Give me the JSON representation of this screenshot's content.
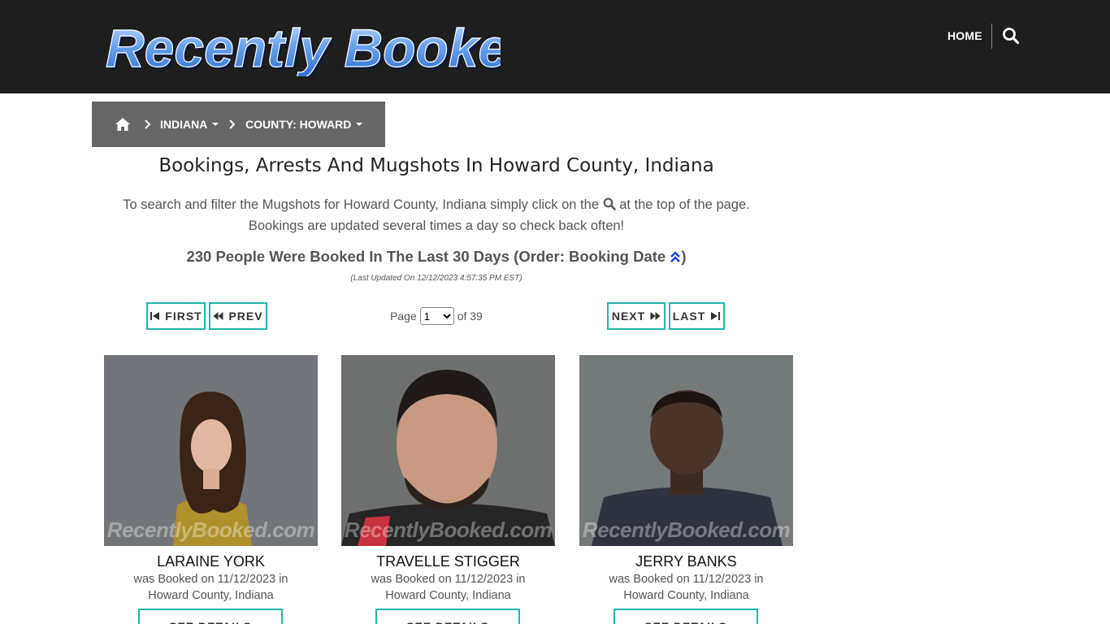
{
  "header": {
    "logo_text": "Recently Booked",
    "nav_home": "HOME"
  },
  "breadcrumb": {
    "state": "INDIANA",
    "county": "COUNTY: HOWARD"
  },
  "main": {
    "title": "Bookings, Arrests And Mugshots In Howard County, Indiana",
    "intro_part1": "To search and filter the Mugshots for Howard County, Indiana simply click on the",
    "intro_part2": "at the top of the page.",
    "intro_line2": "Bookings are updated several times a day so check back often!",
    "count_text": "230 People Were Booked In The Last 30 Days (Order: Booking Date",
    "count_close": ")",
    "last_updated": "(Last Updated On 12/12/2023 4:57:35 PM EST)"
  },
  "pagination": {
    "first": "FIRST",
    "prev": "PREV",
    "next": "NEXT",
    "last": "LAST",
    "page_label": "Page",
    "current_page": "1",
    "of_label": "of 39"
  },
  "bookings": [
    {
      "name": "LARAINE YORK",
      "booked_line1": "was Booked on 11/12/2023 in",
      "booked_line2": "Howard County, Indiana",
      "details_label": "SEE DETAILS",
      "watermark": "RecentlyBooked.com"
    },
    {
      "name": "TRAVELLE STIGGER",
      "booked_line1": "was Booked on 11/12/2023 in",
      "booked_line2": "Howard County, Indiana",
      "details_label": "SEE DETAILS",
      "watermark": "RecentlyBooked.com"
    },
    {
      "name": "JERRY BANKS",
      "booked_line1": "was Booked on 11/12/2023 in",
      "booked_line2": "Howard County, Indiana",
      "details_label": "SEE DETAILS",
      "watermark": "RecentlyBooked.com"
    }
  ],
  "colors": {
    "header_bg": "#1e1e1e",
    "breadcrumb_bg": "#666666",
    "button_border": "#22b5ac",
    "logo_blue": "#4f8fe6",
    "sort_icon": "#1a3fd6"
  },
  "icons": {
    "nav_search": "search-icon",
    "breadcrumb_home": "home-icon",
    "breadcrumb_separator": "chevron-right-icon",
    "sort": "double-chevron-up-icon",
    "first": "skip-back-icon",
    "prev": "rewind-icon",
    "next": "fast-forward-icon",
    "last": "skip-forward-icon"
  }
}
